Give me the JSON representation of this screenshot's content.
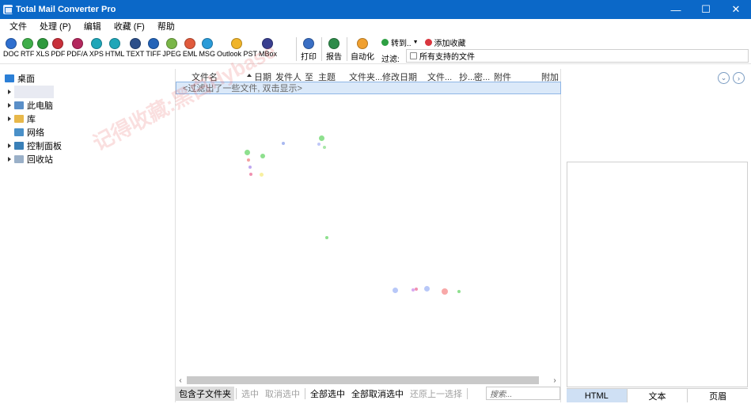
{
  "window": {
    "title": "Total Mail Converter Pro",
    "controls": {
      "minimize": "—",
      "maximize": "☐",
      "close": "✕"
    }
  },
  "menu": [
    "文件",
    "处理 (P)",
    "编辑",
    "收藏 (F)",
    "帮助"
  ],
  "toolbar": {
    "formats": [
      {
        "label": "DOC",
        "icon": "doc-icon",
        "color": "#2f6fcf"
      },
      {
        "label": "RTF",
        "icon": "rtf-icon",
        "color": "#3fae4a"
      },
      {
        "label": "XLS",
        "icon": "xls-icon",
        "color": "#2e9a3d"
      },
      {
        "label": "PDF",
        "icon": "pdf-icon",
        "color": "#c8303a"
      },
      {
        "label": "PDF/A",
        "icon": "pdfa-icon",
        "color": "#b3285e"
      },
      {
        "label": "XPS",
        "icon": "xps-icon",
        "color": "#1fa6b8"
      },
      {
        "label": "HTML",
        "icon": "html-icon",
        "color": "#1fa6b8"
      },
      {
        "label": "TEXT",
        "icon": "text-icon",
        "color": "#2c4f8a"
      },
      {
        "label": "TIFF",
        "icon": "tiff-icon",
        "color": "#2363b8"
      },
      {
        "label": "JPEG",
        "icon": "jpeg-icon",
        "color": "#7ab648"
      },
      {
        "label": "EML",
        "icon": "eml-icon",
        "color": "#e05a3c"
      },
      {
        "label": "MSG",
        "icon": "msg-icon",
        "color": "#2a9bd8"
      },
      {
        "label": "Outlook PST",
        "icon": "pst-icon",
        "color": "#f0b429"
      },
      {
        "label": "MBox",
        "icon": "mbox-icon",
        "color": "#3a3f8f"
      }
    ],
    "print": {
      "label": "打印",
      "icon": "printer-icon",
      "color": "#3a6fc4"
    },
    "report": {
      "label": "报告",
      "icon": "report-icon",
      "color": "#2e8b4a"
    },
    "automate": {
      "label": "自动化",
      "icon": "automate-icon",
      "color": "#f0a030"
    },
    "goto": {
      "label": "转到..",
      "color": "#2ea043"
    },
    "add_favorite": {
      "label": "添加收藏",
      "color": "#d9363e"
    },
    "filter_label": "过滤:",
    "filter_value": "所有支持的文件"
  },
  "tree": {
    "items": [
      {
        "label": "桌面",
        "icon": "desktop-icon"
      },
      {
        "label": "",
        "icon": "user-folder-icon"
      },
      {
        "label": "此电脑",
        "icon": "computer-icon"
      },
      {
        "label": "库",
        "icon": "library-icon"
      },
      {
        "label": "网络",
        "icon": "network-icon"
      },
      {
        "label": "控制面板",
        "icon": "control-panel-icon"
      },
      {
        "label": "回收站",
        "icon": "recycle-bin-icon"
      }
    ]
  },
  "file_list": {
    "columns": [
      "文件名",
      "日期",
      "发件人",
      "至",
      "主题",
      "文件夹...",
      "修改日期",
      "文件...",
      "抄...",
      "密...",
      "附件",
      "附加"
    ],
    "filter_hint": "<过滤出了一些文件, 双击显示>"
  },
  "bottom_bar": {
    "include_subfolders": "包含子文件夹",
    "select": "选中",
    "deselect": "取消选中",
    "select_all": "全部选中",
    "deselect_all": "全部取消选中",
    "restore_selection": "还原上一选择",
    "search_placeholder": "搜索..."
  },
  "preview_tabs": [
    "HTML",
    "文本",
    "页眉"
  ],
  "watermark": "记得收藏:黑白Hybase"
}
